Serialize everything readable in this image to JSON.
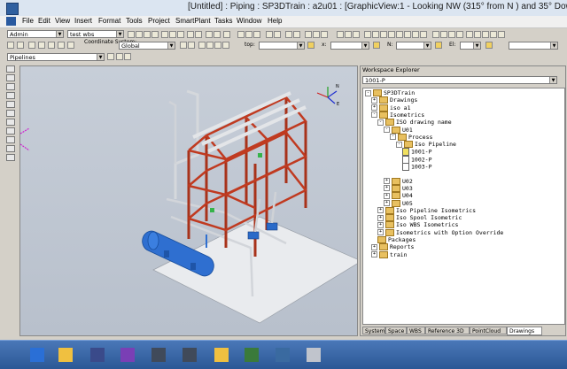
{
  "window": {
    "title": "[Untitled] : Piping : SP3DTrain : a2u01 : [GraphicView:1 - Looking NW (315° from N ) and 35° Dow"
  },
  "menu": [
    "File",
    "Edit",
    "View",
    "Insert",
    "Format",
    "Tools",
    "Project",
    "SmartPlant",
    "Tasks",
    "Window",
    "Help"
  ],
  "toolbar": {
    "permission_group": "Admin",
    "active_wbs": "test wbs",
    "coord_label": "Coordinate System:",
    "coord_value": "Global",
    "top_label": "top:",
    "x_label": "x:",
    "n_label": "N:",
    "el_label": "El:",
    "filter": "Pipelines"
  },
  "workspace": {
    "header": "Workspace Explorer",
    "find_value": "1001-P",
    "tree": [
      {
        "label": "SP3DTrain",
        "indent": 0,
        "icon": "root",
        "exp": "-"
      },
      {
        "label": "Drawings",
        "indent": 1,
        "icon": "folder",
        "exp": "+"
      },
      {
        "label": "iso a1",
        "indent": 1,
        "icon": "folder",
        "exp": "+"
      },
      {
        "label": "Isometrics",
        "indent": 1,
        "icon": "folder",
        "exp": "-"
      },
      {
        "label": "ISO drawing name",
        "indent": 2,
        "icon": "folder",
        "exp": "-"
      },
      {
        "label": "U01",
        "indent": 3,
        "icon": "folder",
        "exp": "-"
      },
      {
        "label": "Process",
        "indent": 4,
        "icon": "folder",
        "exp": "-"
      },
      {
        "label": "Iso Pipeline",
        "indent": 5,
        "icon": "folder",
        "exp": "-"
      },
      {
        "label": "1001-P",
        "indent": 6,
        "icon": "doc-y",
        "exp": ""
      },
      {
        "label": "1002-P",
        "indent": 6,
        "icon": "doc",
        "exp": ""
      },
      {
        "label": "1003-P",
        "indent": 6,
        "icon": "doc",
        "exp": ""
      },
      {
        "label": "",
        "indent": 0,
        "icon": "none",
        "exp": ""
      },
      {
        "label": "U02",
        "indent": 3,
        "icon": "folder",
        "exp": "+"
      },
      {
        "label": "U03",
        "indent": 3,
        "icon": "folder",
        "exp": "+"
      },
      {
        "label": "U04",
        "indent": 3,
        "icon": "folder",
        "exp": "+"
      },
      {
        "label": "U05",
        "indent": 3,
        "icon": "folder",
        "exp": "+"
      },
      {
        "label": "Iso Pipeline Isometrics",
        "indent": 2,
        "icon": "folder",
        "exp": "+"
      },
      {
        "label": "Iso Spool Isometric",
        "indent": 2,
        "icon": "folder",
        "exp": "+"
      },
      {
        "label": "Iso WBS Isometrics",
        "indent": 2,
        "icon": "folder",
        "exp": "+"
      },
      {
        "label": "Isometrics with Option Override",
        "indent": 2,
        "icon": "folder",
        "exp": "+"
      },
      {
        "label": "Packages",
        "indent": 2,
        "icon": "folder",
        "exp": ""
      },
      {
        "label": "Reports",
        "indent": 1,
        "icon": "folder",
        "exp": "+"
      },
      {
        "label": "train",
        "indent": 1,
        "icon": "folder",
        "exp": "+"
      }
    ],
    "tabs": [
      "System",
      "Space",
      "WBS",
      "Reference 3D",
      "PointCloud",
      "Drawings"
    ],
    "selected_tab": "Drawings"
  },
  "taskbar": {
    "icons": [
      "powershell-icon",
      "file-explorer-icon",
      "sp3d-launcher-icon",
      "visual-studio-icon",
      "sp3d-app-icon",
      "sp3d-app-icon-2",
      "folder-sync-icon",
      "smartplant-tools-icon",
      "network-tools-icon",
      "mail-icon"
    ]
  },
  "colors": {
    "steel": "#b33a1f",
    "vessel": "#2f6fd0",
    "pipe": "#d9d9d9",
    "title_bg": "#dbe5f1",
    "taskbar": "#2b5895"
  }
}
